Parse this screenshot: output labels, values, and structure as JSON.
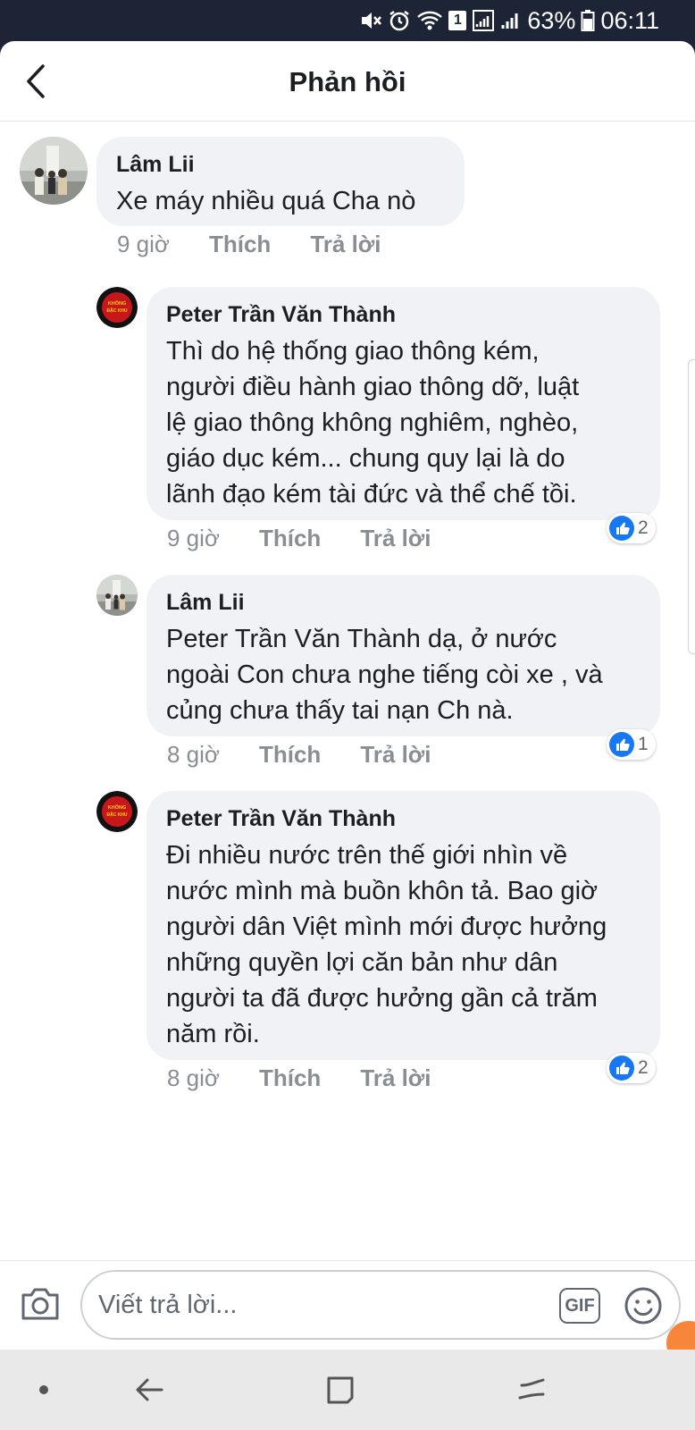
{
  "status_bar": {
    "battery": "63%",
    "time": "06:11",
    "sim": "1"
  },
  "header": {
    "title": "Phản hồi"
  },
  "comments": [
    {
      "author": "Lâm Lii",
      "text": "Xe máy nhiều quá Cha nò",
      "time": "9 giờ",
      "like_label": "Thích",
      "reply_label": "Trả lời"
    },
    {
      "author": "Peter Trần Văn Thành",
      "text": "Thì do hệ thống giao thông kém,\nngười điều hành giao thông dỡ, luật\nlệ giao thông không nghiêm, nghèo,\ngiáo dục kém... chung quy lại là do\nlãnh đạo kém tài đức và thể chế tồi.",
      "time": "9 giờ",
      "like_label": "Thích",
      "reply_label": "Trả lời",
      "reactions": "2",
      "avatar_text": [
        "KHÔNG",
        "ĐẶC KHU"
      ]
    },
    {
      "author": "Lâm Lii",
      "text": "Peter Trần Văn Thành dạ, ở nước\nngoài Con chưa nghe tiếng còi xe , và\ncủng chưa thấy tai nạn Ch nà.",
      "time": "8 giờ",
      "like_label": "Thích",
      "reply_label": "Trả lời",
      "reactions": "1"
    },
    {
      "author": "Peter Trần Văn Thành",
      "text": "Đi nhiều nước trên thế giới nhìn về\nnước mình mà buồn khôn tả. Bao giờ\nngười dân Việt mình mới được hưởng\nnhững quyền lợi căn bản như dân\nngười ta đã được hưởng gần cả trăm\nnăm rồi.",
      "time": "8 giờ",
      "like_label": "Thích",
      "reply_label": "Trả lời",
      "reactions": "2",
      "avatar_text": [
        "KHÔNG",
        "ĐẶC KHU"
      ]
    }
  ],
  "composer": {
    "placeholder": "Viết trả lời...",
    "gif_label": "GIF"
  },
  "colors": {
    "like_blue": "#1877f2",
    "bubble": "#f0f2f5",
    "meta_gray": "#8a8d91",
    "accent_orange": "#f7853a"
  },
  "icons": [
    "back-arrow-icon",
    "like-thumb-icon",
    "camera-icon",
    "gif-icon",
    "emoji-icon",
    "nav-dot-icon",
    "nav-back-icon",
    "nav-recents-icon",
    "nav-menu-icon"
  ]
}
